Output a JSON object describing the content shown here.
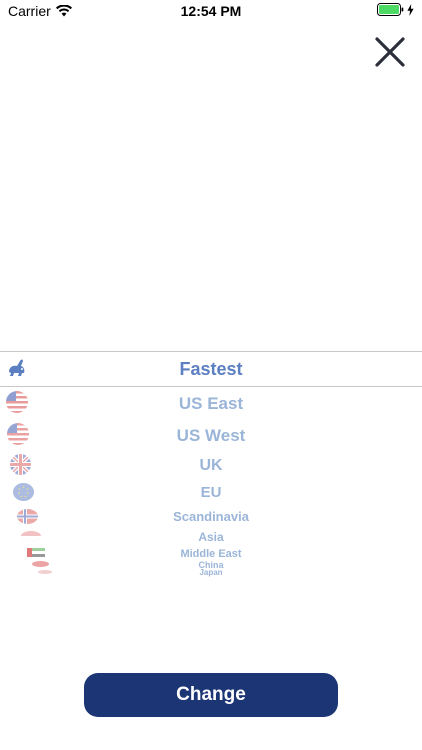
{
  "status_bar": {
    "carrier": "Carrier",
    "time": "12:54 PM",
    "wifi_icon": "wifi-icon",
    "battery_icon": "battery-full-icon",
    "charging_icon": "charging-bolt-icon",
    "battery_color": "#4cd964"
  },
  "close": {
    "icon": "close-icon",
    "color": "#2b2f3a"
  },
  "picker": {
    "selected": "Fastest",
    "items": [
      {
        "label": "Fastest",
        "icon": "rabbit-icon"
      },
      {
        "label": "US East",
        "icon": "us-flag-icon"
      },
      {
        "label": "US West",
        "icon": "us-flag-icon"
      },
      {
        "label": "UK",
        "icon": "uk-flag-icon"
      },
      {
        "label": "EU",
        "icon": "eu-flag-icon"
      },
      {
        "label": "Scandinavia",
        "icon": "norway-flag-icon"
      },
      {
        "label": "Asia",
        "icon": "singapore-flag-icon"
      },
      {
        "label": "Middle East",
        "icon": "uae-flag-icon"
      },
      {
        "label": "China",
        "icon": "china-flag-icon"
      },
      {
        "label": "Japan",
        "icon": "japan-flag-icon"
      }
    ]
  },
  "colors": {
    "selected_text": "#5b7fc1",
    "faded_text": "#9bb5d8",
    "button_bg": "#1c3575"
  },
  "change_button": {
    "label": "Change"
  }
}
